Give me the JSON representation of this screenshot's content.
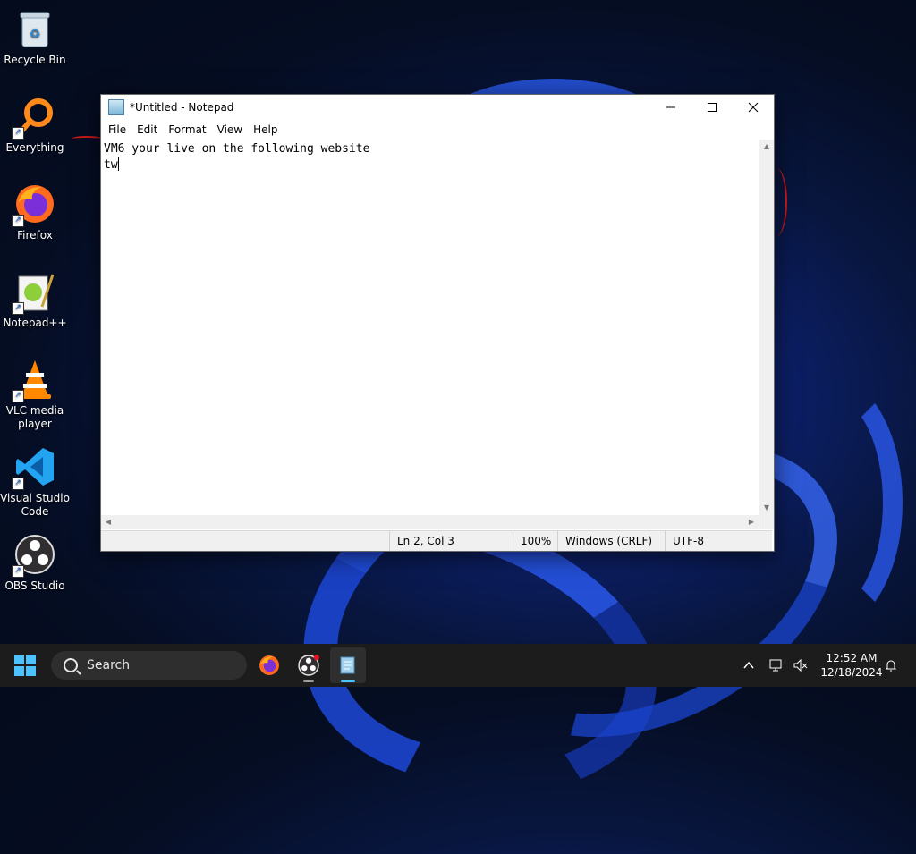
{
  "desktop": {
    "icons": [
      {
        "label": "Recycle Bin",
        "icon": "recycle-bin-icon"
      },
      {
        "label": "Everything",
        "icon": "everything-icon"
      },
      {
        "label": "Firefox",
        "icon": "firefox-icon"
      },
      {
        "label": "Notepad++",
        "icon": "notepadpp-icon"
      },
      {
        "label": "VLC media player",
        "icon": "vlc-icon"
      },
      {
        "label": "Visual Studio Code",
        "icon": "vscode-icon"
      },
      {
        "label": "OBS Studio",
        "icon": "obs-icon"
      }
    ]
  },
  "notepad": {
    "title": "*Untitled - Notepad",
    "menu": [
      "File",
      "Edit",
      "Format",
      "View",
      "Help"
    ],
    "lines": [
      "VM6 your live on the following website",
      "tw"
    ],
    "status": {
      "position": "Ln 2, Col 3",
      "zoom": "100%",
      "line_ending": "Windows (CRLF)",
      "encoding": "UTF-8"
    }
  },
  "taskbar": {
    "search_placeholder": "Search",
    "time": "12:52 AM",
    "date": "12/18/2024",
    "apps": [
      "firefox-icon",
      "obs-icon",
      "notepad-icon"
    ],
    "active_app": "notepad-icon"
  },
  "colors": {
    "accent": "#4cc2ff",
    "taskbar_bg": "#1c1c1c",
    "wallpaper_blue": "#1e4ce0"
  }
}
